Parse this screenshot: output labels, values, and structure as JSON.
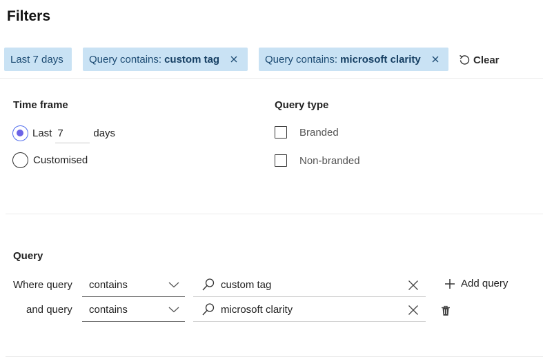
{
  "header": {
    "title": "Filters"
  },
  "chips": [
    {
      "label": "Last 7 days"
    },
    {
      "prefix": "Query contains:",
      "value": "custom tag",
      "close_icon": "close-icon"
    },
    {
      "prefix": "Query contains:",
      "value": "microsoft clarity",
      "close_icon": "close-icon"
    }
  ],
  "clear": {
    "label": "Clear",
    "icon": "undo-icon"
  },
  "time_frame": {
    "label": "Time frame",
    "last_label": "Last",
    "days_value": "7",
    "days_label": "days",
    "customised_label": "Customised",
    "selected": "last"
  },
  "query_type": {
    "label": "Query type",
    "options": [
      "Branded",
      "Non-branded"
    ]
  },
  "query": {
    "label": "Query",
    "rows": [
      {
        "prefix": "Where query",
        "operator": "contains",
        "value": "custom tag"
      },
      {
        "prefix": "and query",
        "operator": "contains",
        "value": "microsoft clarity"
      }
    ],
    "add_label": "Add query"
  },
  "colors": {
    "chip_bg": "#c9e2f4",
    "chip_text": "#1b4a72",
    "radio_accent": "#6b63e6"
  }
}
